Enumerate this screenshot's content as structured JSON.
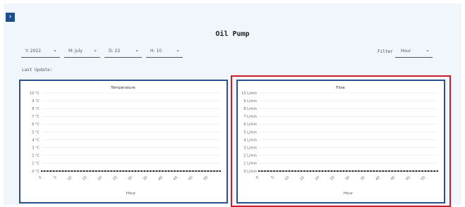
{
  "toggle": {
    "icon": "chevron-right-icon",
    "glyph": "›"
  },
  "page": {
    "title": "Oil Pump"
  },
  "selectors": {
    "year": "Y: 2022",
    "month": "M: July",
    "day": "D: 22",
    "hour": "H: 10",
    "chevron": "⌄"
  },
  "filter": {
    "label": "Filter",
    "value": "Hour"
  },
  "last_update": {
    "label": "Last Update:"
  },
  "colors": {
    "panel_border": "#2d4f8e",
    "highlight": "#cc1c2b",
    "toggle_bg": "#1e4f8c",
    "background": "#f1f5fc"
  },
  "chart_data": [
    {
      "type": "line",
      "title": "Temperature",
      "xlabel": "Hour",
      "ylabel": "",
      "y_ticks": [
        "0 °C",
        "1 °C",
        "2 °C",
        "3 °C",
        "4 °C",
        "5 °C",
        "6 °C",
        "7 °C",
        "8 °C",
        "9 °C",
        "10 °C"
      ],
      "ylim": [
        0,
        10
      ],
      "x_ticks": [
        "0",
        "5",
        "10",
        "15",
        "20",
        "25",
        "30",
        "35",
        "40",
        "45",
        "50",
        "55"
      ],
      "xlim": [
        0,
        59
      ],
      "series": [
        {
          "values": [
            0,
            0,
            0,
            0,
            0,
            0,
            0,
            0,
            0,
            0,
            0,
            0,
            0,
            0,
            0,
            0,
            0,
            0,
            0,
            0,
            0,
            0,
            0,
            0,
            0,
            0,
            0,
            0,
            0,
            0,
            0,
            0,
            0,
            0,
            0,
            0,
            0,
            0,
            0,
            0,
            0,
            0,
            0,
            0,
            0,
            0,
            0,
            0,
            0,
            0,
            0,
            0,
            0,
            0,
            0,
            0,
            0,
            0,
            0,
            0
          ]
        }
      ],
      "grid": true
    },
    {
      "type": "line",
      "title": "Flow",
      "xlabel": "Hour",
      "ylabel": "",
      "y_ticks": [
        "0 L/min",
        "1 L/min",
        "2 L/min",
        "3 L/min",
        "4 L/min",
        "5 L/min",
        "6 L/min",
        "7 L/min",
        "8 L/min",
        "9 L/min",
        "10 L/min"
      ],
      "ylim": [
        0,
        10
      ],
      "x_ticks": [
        "0",
        "5",
        "10",
        "15",
        "20",
        "25",
        "30",
        "35",
        "40",
        "45",
        "50",
        "55"
      ],
      "xlim": [
        0,
        59
      ],
      "series": [
        {
          "values": [
            0,
            0,
            0,
            0,
            0,
            0,
            0,
            0,
            0,
            0,
            0,
            0,
            0,
            0,
            0,
            0,
            0,
            0,
            0,
            0,
            0,
            0,
            0,
            0,
            0,
            0,
            0,
            0,
            0,
            0,
            0,
            0,
            0,
            0,
            0,
            0,
            0,
            0,
            0,
            0,
            0,
            0,
            0,
            0,
            0,
            0,
            0,
            0,
            0,
            0,
            0,
            0,
            0,
            0,
            0,
            0,
            0,
            0,
            0,
            0
          ]
        }
      ],
      "grid": true
    }
  ]
}
